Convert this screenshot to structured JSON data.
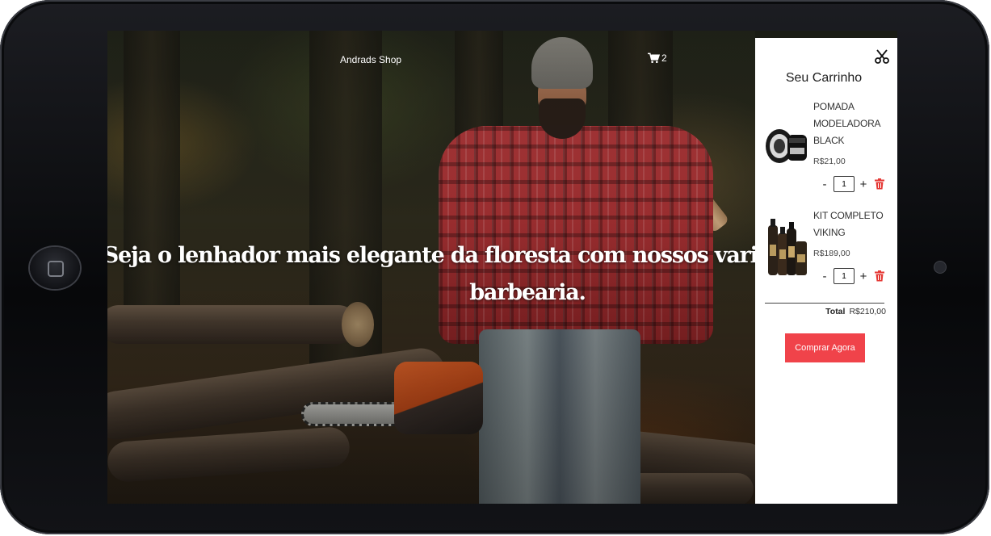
{
  "header": {
    "brand": "Andrads Shop",
    "cart_count": "2"
  },
  "hero": {
    "headline": "Seja o lenhador mais elegante da floresta com nossos variados produtos de barbearia."
  },
  "cart": {
    "title": "Seu Carrinho",
    "items": [
      {
        "name": "POMADA MODELADORA BLACK",
        "price": "R$21,00",
        "quantity": "1",
        "image_icon": "pomade-jar-image"
      },
      {
        "name": "KIT COMPLETO VIKING",
        "price": "R$189,00",
        "quantity": "1",
        "image_icon": "beard-kit-bottles-image"
      }
    ],
    "decrement_label": "-",
    "increment_label": "+",
    "total_label": "Total",
    "total_value": "R$210,00",
    "buy_label": "Comprar Agora"
  },
  "colors": {
    "accent": "#f0434a",
    "trash": "#e53935",
    "panel": "#ffffff"
  }
}
